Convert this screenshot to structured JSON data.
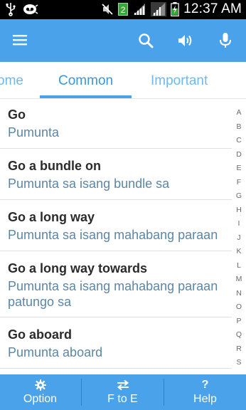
{
  "status_bar": {
    "sim_badge": "2",
    "time": "12:37 AM"
  },
  "app_bar": {
    "icons": [
      "menu-icon",
      "search-icon",
      "speaker-icon",
      "microphone-icon"
    ]
  },
  "tabs": [
    {
      "label": "Home",
      "visible_text": "ome",
      "active": false
    },
    {
      "label": "Common",
      "active": true
    },
    {
      "label": "Important",
      "active": false
    }
  ],
  "phrases": [
    {
      "english": "Go",
      "filipino": "Pumunta"
    },
    {
      "english": "Go a bundle on",
      "filipino": "Pumunta sa isang bundle sa"
    },
    {
      "english": "Go a long way",
      "filipino": "Pumunta sa isang mahabang paraan"
    },
    {
      "english": "Go a long way towards",
      "filipino_line1": "Pumunta sa isang mahabang paraan",
      "filipino_line2": "patungo sa"
    },
    {
      "english": "Go aboard",
      "filipino": "Pumunta aboard"
    }
  ],
  "alphabet": [
    "A",
    "B",
    "C",
    "D",
    "E",
    "F",
    "G",
    "H",
    "I",
    "J",
    "K",
    "L",
    "M",
    "N",
    "O",
    "P",
    "Q",
    "R",
    "S"
  ],
  "bottom_bar": {
    "option_label": "Option",
    "translate_label": "F to E",
    "help_label": "Help",
    "help_icon": "?"
  },
  "colors": {
    "primary": "#4aa3ea",
    "tab_active": "#3d95dc",
    "translation_text": "#5b87a5"
  }
}
